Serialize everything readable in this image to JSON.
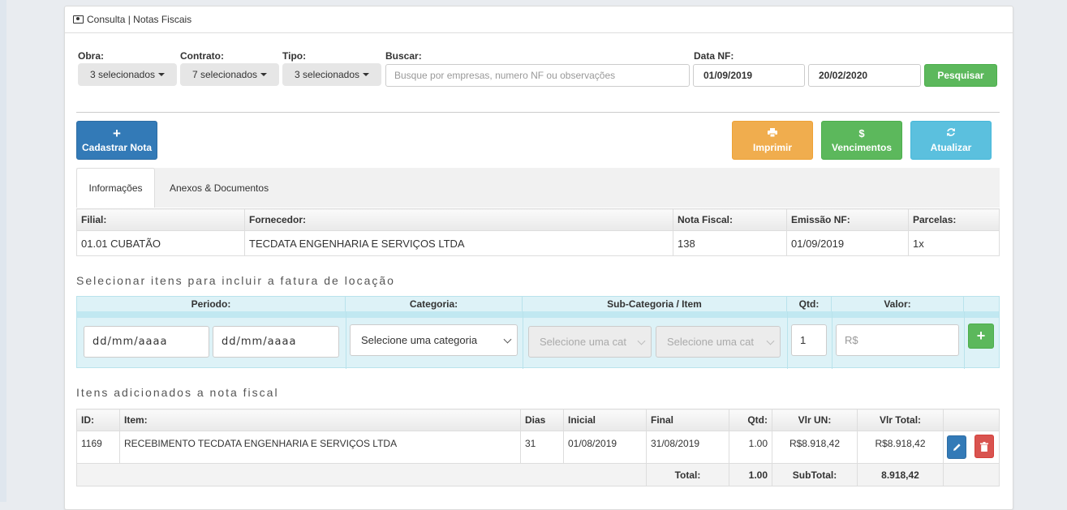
{
  "header": {
    "title": "Consulta | Notas Fiscais"
  },
  "filters": {
    "obra_label": "Obra:",
    "obra_value": "3 selecionados",
    "contrato_label": "Contrato:",
    "contrato_value": "7 selecionados",
    "tipo_label": "Tipo:",
    "tipo_value": "3 selecionados",
    "buscar_label": "Buscar:",
    "buscar_placeholder": "Busque por empresas, numero NF ou observações",
    "data_label": "Data NF:",
    "data_inicio": "01/09/2019",
    "data_fim": "20/02/2020",
    "pesquisar_label": "Pesquisar"
  },
  "actions": {
    "cadastrar_icon": "+",
    "cadastrar_label": "Cadastrar Nota",
    "imprimir_icon": "print-icon",
    "imprimir_label": "Imprimir",
    "vencimentos_icon": "$",
    "vencimentos_label": "Vencimentos",
    "atualizar_icon": "refresh-icon",
    "atualizar_label": "Atualizar"
  },
  "colors": {
    "primary": "#337ab7",
    "success": "#5cb85c",
    "warning": "#f0ad4e",
    "info": "#5bc0de",
    "danger": "#d9534f"
  },
  "tabs": [
    {
      "label": "Informações"
    },
    {
      "label": "Anexos & Documentos"
    }
  ],
  "info": {
    "headers": [
      "Filial:",
      "Fornecedor:",
      "Nota Fiscal:",
      "Emissão NF:",
      "Parcelas:"
    ],
    "row": [
      "01.01 CUBATÃO",
      "TECDATA ENGENHARIA E SERVIÇOS LTDA",
      "138",
      "01/09/2019",
      "1x"
    ]
  },
  "select_section": {
    "title": "Selecionar itens para incluir a fatura de locação",
    "headers": {
      "periodo": "Periodo:",
      "categoria": "Categoria:",
      "subcategoria": "Sub-Categoria / Item",
      "qtd": "Qtd:",
      "valor": "Valor:"
    },
    "periodo_inicio_placeholder": "dd/mm/aaaa",
    "periodo_fim_placeholder": "dd/mm/aaaa",
    "categoria_value": "Selecione uma categoria",
    "subcategoria_value": "Selecione uma cat",
    "item_value": "Selecione uma cat",
    "qtd_value": "1",
    "valor_placeholder": "R$",
    "add_icon": "+"
  },
  "items_section": {
    "title": "Itens adicionados a nota fiscal",
    "headers": [
      "ID:",
      "Item:",
      "Dias",
      "Inicial",
      "Final",
      "Qtd:",
      "Vlr UN:",
      "Vlr Total:"
    ],
    "rows": [
      {
        "id": "1169",
        "item": "RECEBIMENTO TECDATA ENGENHARIA E SERVIÇOS LTDA",
        "dias": "31",
        "inicial": "01/08/2019",
        "final": "31/08/2019",
        "qtd": "1.00",
        "vlr_un": "R$8.918,42",
        "vlr_total": "R$8.918,42"
      }
    ],
    "total_label": "Total:",
    "total_qtd": "1.00",
    "subtotal_label": "SubTotal:",
    "subtotal_value": "8.918,42"
  }
}
